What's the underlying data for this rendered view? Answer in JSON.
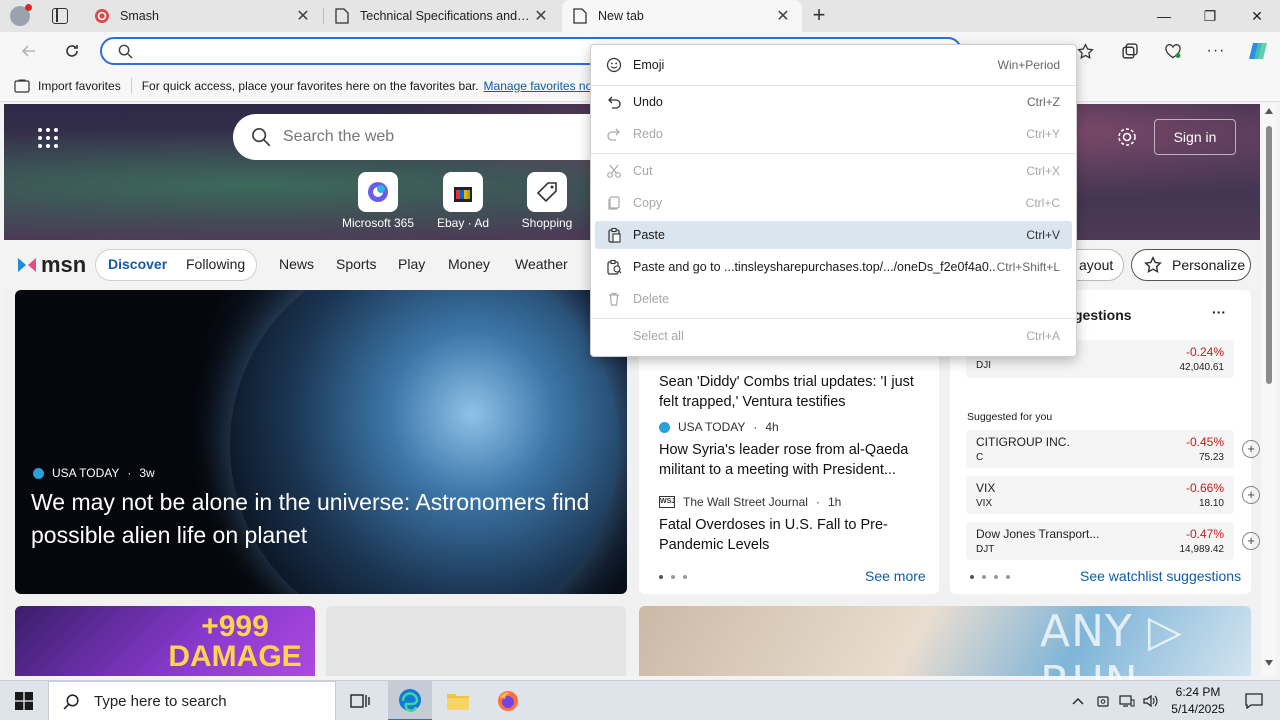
{
  "tabs": [
    {
      "title": "Smash",
      "close": "✕"
    },
    {
      "title": "Technical Specifications and Vendor",
      "close": "✕"
    },
    {
      "title": "New tab",
      "close": "✕"
    }
  ],
  "new_tab_symbol": "+",
  "window_controls": {
    "minimize": "—",
    "maximize": "❐",
    "close": "✕"
  },
  "address_bar": {
    "value": "",
    "placeholder": ""
  },
  "favorites_bar": {
    "import_label": "Import favorites",
    "message": "For quick access, place your favorites here on the favorites bar.",
    "link": "Manage favorites now"
  },
  "newtab": {
    "search_placeholder": "Search the web",
    "sign_in": "Sign in",
    "quick_links": [
      {
        "label": "Microsoft 365"
      },
      {
        "label": "Ebay · Ad"
      },
      {
        "label": "Shopping"
      }
    ]
  },
  "msn": {
    "logo": "msn",
    "tabs": [
      "Discover",
      "Following"
    ],
    "nav": [
      "News",
      "Sports",
      "Play",
      "Money",
      "Weather"
    ],
    "layout_label": "ayout",
    "personalize": "Personalize"
  },
  "feature": {
    "source": "USA TODAY",
    "age": "3w",
    "headline": "We may not be alone in the universe: Astronomers find possible alien life on planet"
  },
  "news_list": [
    {
      "source": "",
      "age": "",
      "headline": "Sean 'Diddy' Combs trial updates: 'I just felt trapped,' Ventura testifies"
    },
    {
      "source": "USA TODAY",
      "age": "4h",
      "headline": "How Syria's leader rose from al-Qaeda militant to a meeting with President..."
    },
    {
      "source": "The Wall Street Journal",
      "age": "1h",
      "headline": "Fatal Overdoses in U.S. Fall to Pre-Pandemic Levels"
    }
  ],
  "news_see_more": "See more",
  "watchlist": {
    "title": "gestions",
    "more": "···",
    "top": {
      "ticker": "DJI",
      "pct": "-0.24%",
      "value": "42,040.61"
    },
    "suggested_label": "Suggested for you",
    "items": [
      {
        "name": "CITIGROUP INC.",
        "ticker": "C",
        "pct": "-0.45%",
        "value": "75.23"
      },
      {
        "name": "VIX",
        "ticker": "VIX",
        "pct": "-0.66%",
        "value": "18.10"
      },
      {
        "name": "Dow Jones Transport...",
        "ticker": "DJT",
        "pct": "-0.47%",
        "value": "14,989.42"
      }
    ],
    "see_link": "See watchlist suggestions"
  },
  "promo": {
    "text": "+999 DAMAGE"
  },
  "context_menu": [
    {
      "label": "Emoji",
      "shortcut": "Win+Period",
      "icon": "emoji-icon",
      "enabled": true
    },
    {
      "label": "Undo",
      "shortcut": "Ctrl+Z",
      "icon": "undo-icon",
      "enabled": true
    },
    {
      "label": "Redo",
      "shortcut": "Ctrl+Y",
      "icon": "redo-icon",
      "enabled": false
    },
    {
      "label": "Cut",
      "shortcut": "Ctrl+X",
      "icon": "cut-icon",
      "enabled": false
    },
    {
      "label": "Copy",
      "shortcut": "Ctrl+C",
      "icon": "copy-icon",
      "enabled": false
    },
    {
      "label": "Paste",
      "shortcut": "Ctrl+V",
      "icon": "paste-icon",
      "enabled": true,
      "highlighted": true
    },
    {
      "label": "Paste and go to ...tinsleysharepurchases.top/.../oneDs_f2e0f4a0...",
      "shortcut": "Ctrl+Shift+L",
      "icon": "paste-go-icon",
      "enabled": true
    },
    {
      "label": "Delete",
      "shortcut": "",
      "icon": "delete-icon",
      "enabled": false
    },
    {
      "label": "Select all",
      "shortcut": "Ctrl+A",
      "icon": "",
      "enabled": false
    }
  ],
  "watermark": "ANY ▷ RUN",
  "taskbar": {
    "search_placeholder": "Type here to search",
    "time": "6:24 PM",
    "date": "5/14/2025"
  },
  "colors": {
    "accent": "#2a6fd8",
    "link": "#0b5cad",
    "negative": "#c81b1b",
    "menu_highlight": "#dbe5f0"
  }
}
